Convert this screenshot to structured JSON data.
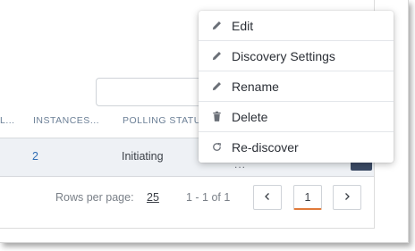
{
  "table": {
    "columns": [
      "L...",
      "INSTANCES...",
      "POLLING STATU"
    ],
    "rows": [
      {
        "instances": "2",
        "polling_status": "Initiating",
        "more": "..."
      }
    ]
  },
  "pagination": {
    "rows_per_page_label": "Rows per page:",
    "rows_per_page_value": "25",
    "range": "1 - 1 of 1",
    "current_page": "1",
    "prev_icon": "chevron-left-icon",
    "next_icon": "chevron-right-icon"
  },
  "context_menu": {
    "items": [
      {
        "label": "Edit",
        "icon": "pencil-icon"
      },
      {
        "label": "Discovery Settings",
        "icon": "pencil-icon"
      },
      {
        "label": "Rename",
        "icon": "pencil-icon"
      },
      {
        "label": "Delete",
        "icon": "trash-icon"
      },
      {
        "label": "Re-discover",
        "icon": "refresh-icon"
      }
    ]
  },
  "colors": {
    "link": "#2f6db5",
    "header_text": "#6b7f96",
    "row_highlight": "#eef1f5",
    "current_page_accent": "#e07a3a"
  }
}
